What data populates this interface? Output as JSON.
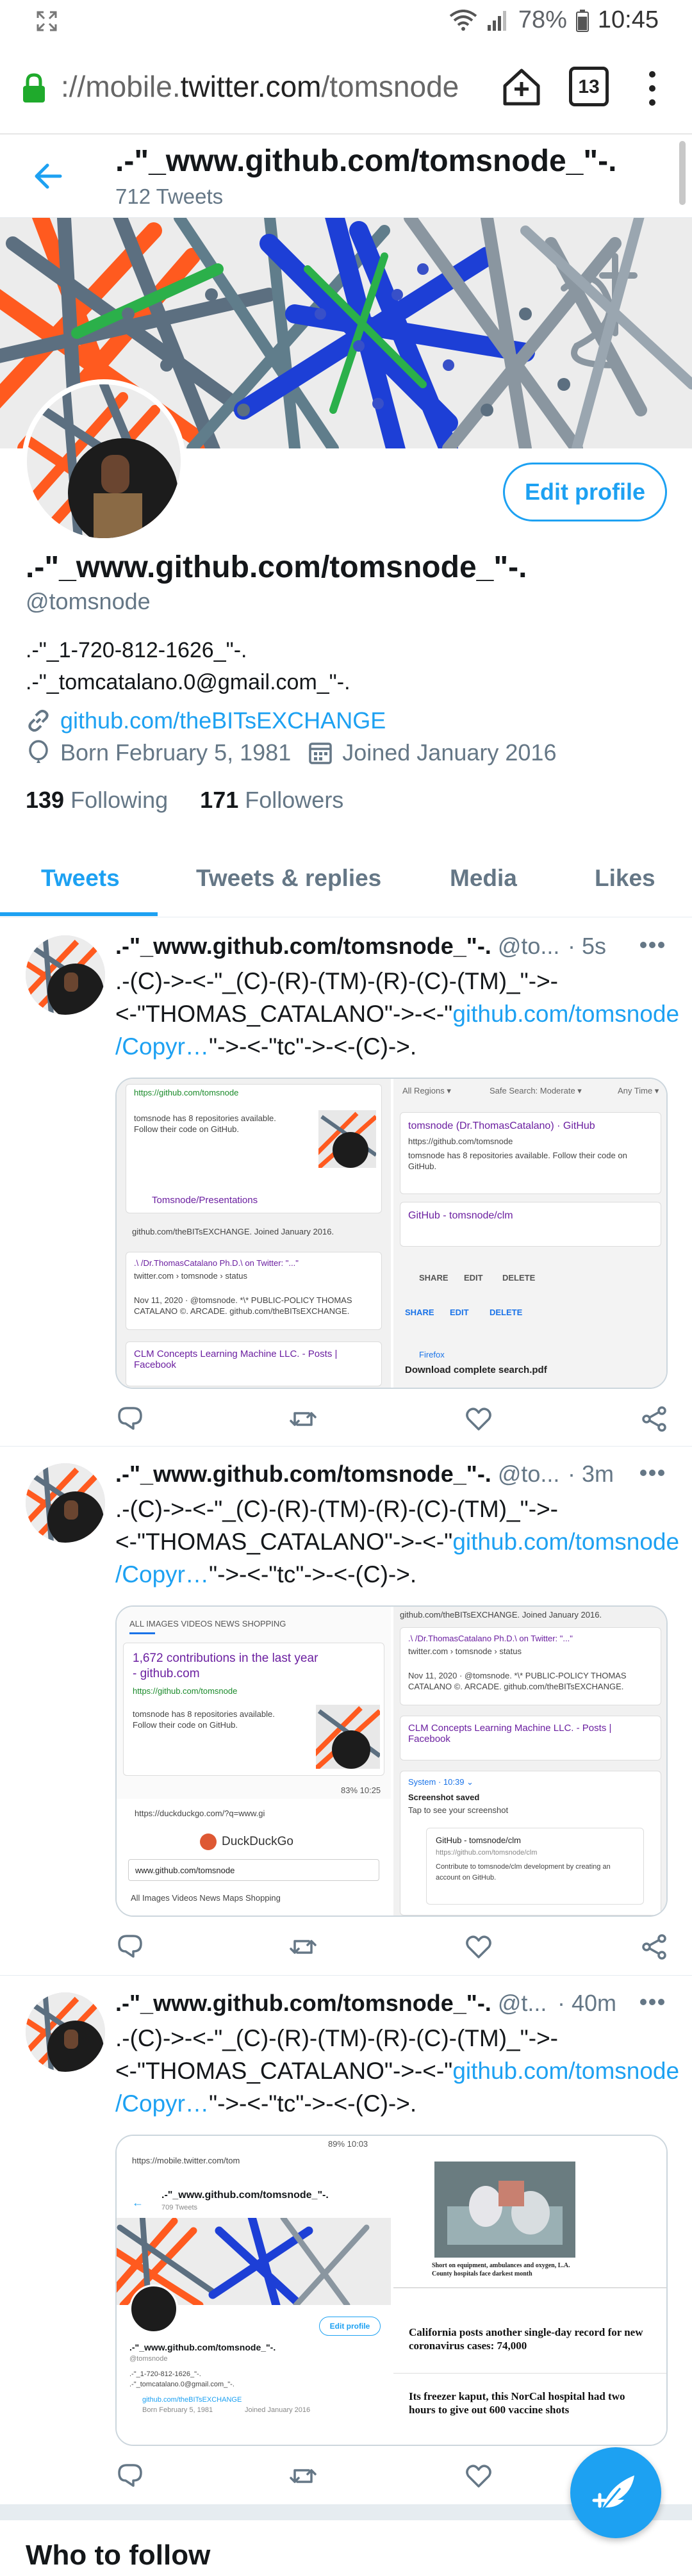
{
  "status": {
    "battery": "78%",
    "time": "10:45"
  },
  "browser": {
    "url_prefix": "://mobile.",
    "url_domain": "twitter.com",
    "url_path": "/tomsnode",
    "tab_count": "13"
  },
  "header": {
    "name": ".-\"_www.github.com/tomsnode_\"-.",
    "tweet_count": "712 Tweets"
  },
  "profile": {
    "name": ".-\"_www.github.com/tomsnode_\"-.",
    "handle": "@tomsnode",
    "bio": ".-\"_1-720-812-1626_\"-.\n.-\"_tomcatalano.0@gmail.com_\"-.",
    "website": "github.com/theBITsEXCHANGE",
    "born": "Born February 5, 1981",
    "joined": "Joined January 2016",
    "following_count": "139",
    "following_label": "Following",
    "followers_count": "171",
    "followers_label": "Followers",
    "edit_label": "Edit profile"
  },
  "tabs": [
    "Tweets",
    "Tweets & replies",
    "Media",
    "Likes"
  ],
  "tweets": [
    {
      "name": ".-\"_www.github.com/tomsnode_\"-.",
      "handle": "@to...",
      "time": "· 5s",
      "text_a": ".-(C)->-<-\"_(C)-(R)-(TM)-(R)-(C)-(TM)_\"->-\n<-\"THOMAS_CATALANO\"->-<-\"",
      "link_a": "github.com/tomsnode",
      "link_b": "/Copyr…",
      "text_b": "\"->-<-\"tc\"->-<-(C)->."
    },
    {
      "name": ".-\"_www.github.com/tomsnode_\"-.",
      "handle": "@to...",
      "time": "· 3m",
      "text_a": ".-(C)->-<-\"_(C)-(R)-(TM)-(R)-(C)-(TM)_\"->-\n<-\"THOMAS_CATALANO\"->-<-\"",
      "link_a": "github.com/tomsnode",
      "link_b": "/Copyr…",
      "text_b": "\"->-<-\"tc\"->-<-(C)->."
    },
    {
      "name": ".-\"_www.github.com/tomsnode_\"-.",
      "handle": "@t...",
      "time": "· 40m",
      "text_a": ".-(C)->-<-\"_(C)-(R)-(TM)-(R)-(C)-(TM)_\"->-\n<-\"THOMAS_CATALANO\"->-<-\"",
      "link_a": "github.com/tomsnode",
      "link_b": "/Copyr…",
      "text_b": "\"->-<-\"tc\"->-<-(C)->."
    }
  ],
  "media": {
    "m1_url": "https://github.com/tomsnode",
    "m1_desc": "tomsnode has 8 repositories available. Follow their code on GitHub.",
    "m1_repo": "Tomsnode/Presentations",
    "m1_join": "github.com/theBITsEXCHANGE. Joined January 2016.",
    "m1_tw_title": ".\\ /Dr.ThomasCatalano Ph.D.\\ on Twitter: \"...\"",
    "m1_tw_sub": "twitter.com › tomsnode › status",
    "m1_date": "Nov 11, 2020 · @tomsnode. *\\* PUBLIC-POLICY THOMAS CATALANO ©. ARCADE. github.com/theBITsEXCHANGE.",
    "m1_clm": "CLM Concepts Learning Machine LLC. - Posts | Facebook",
    "m1_regions": "All Regions ▾",
    "m1_safe": "Safe Search: Moderate ▾",
    "m1_time": "Any Time ▾",
    "m1_gh_title": "tomsnode (Dr.ThomasCatalano) · GitHub",
    "m1_gh_url": "https://github.com/tomsnode",
    "m1_gh_desc": "tomsnode has 8 repositories available. Follow their code on GitHub.",
    "m1_clm_repo": "GitHub - tomsnode/clm",
    "m1_share": "SHARE",
    "m1_edit": "EDIT",
    "m1_delete": "DELETE",
    "m1_firefox": "Firefox",
    "m1_download": "Download complete search.pdf",
    "m1_pres": "Tomsnode/Presentations",
    "m2_tabs": "ALL   IMAGES   VIDEOS   NEWS   SHOPPING",
    "m2_contrib": "1,672 contributions in the last year - github.com",
    "m2_url": "https://github.com/tomsnode",
    "m2_desc": "tomsnode has 8 repositories available. Follow their code on GitHub.",
    "m2_status": "83% 10:25",
    "m2_ddg_url": "https://duckduckgo.com/?q=www.gi",
    "m2_ddg": "DuckDuckGo",
    "m2_search": "www.github.com/tomsnode",
    "m2_filters": "All   Images   Videos   News   Maps   Shopping",
    "m2_join": "github.com/theBITsEXCHANGE. Joined January 2016.",
    "m2_tw_title": ".\\ /Dr.ThomasCatalano Ph.D.\\ on Twitter: \"...\"",
    "m2_tw_sub": "twitter.com › tomsnode › status",
    "m2_date": "Nov 11, 2020 · @tomsnode. *\\* PUBLIC-POLICY THOMAS CATALANO ©. ARCADE. github.com/theBITsEXCHANGE.",
    "m2_clm": "CLM Concepts Learning Machine LLC. - Posts | Facebook",
    "m2_system": "System · 10:39 ⌄",
    "m2_saved": "Screenshot saved",
    "m2_tap": "Tap to see your screenshot",
    "m2_gh_clm": "GitHub - tomsnode/clm",
    "m2_gh_clm_url": "https://github.com/tomsnode/clm",
    "m2_gh_clm_desc": "Contribute to tomsnode/clm development by creating an account on GitHub.",
    "m3_status": "89% 10:03",
    "m3_url": "https://mobile.twitter.com/tom",
    "m3_name": ".-\"_www.github.com/tomsnode_\"-.",
    "m3_count": "709 Tweets",
    "m3_edit": "Edit profile",
    "m3_pname": ".-\"_www.github.com/tomsnode_\"-.",
    "m3_handle": "@tomsnode",
    "m3_bio1": ".-\"_1-720-812-1626_\"-.",
    "m3_bio2": ".-\"_tomcatalano.0@gmail.com_\"-.",
    "m3_link": "github.com/theBITsEXCHANGE",
    "m3_born": "Born February 5, 1981",
    "m3_joined": "Joined January 2016",
    "m3_news_caption": "Short on equipment, ambulances and oxygen, L.A. County hospitals face darkest month",
    "m3_headline1": "California posts another single-day record for new coronavirus cases: 74,000",
    "m3_headline2": "Its freezer kaput, this NorCal hospital had two hours to give out 600 vaccine shots"
  },
  "who_to_follow": "Who to follow",
  "colors": {
    "accent": "#1da1f2",
    "text": "#14171a",
    "muted": "#657786"
  }
}
